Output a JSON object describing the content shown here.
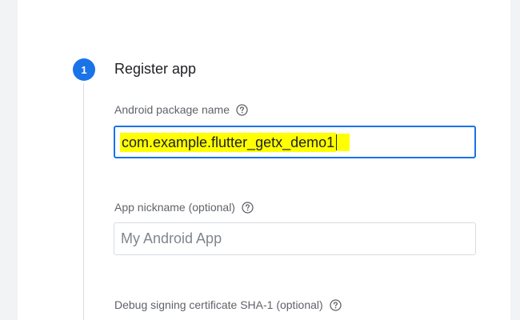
{
  "step": {
    "number": "1",
    "title": "Register app"
  },
  "fields": {
    "package_name": {
      "label": "Android package name",
      "value": "com.example.flutter_getx_demo1"
    },
    "nickname": {
      "label": "App nickname (optional)",
      "placeholder": "My Android App"
    },
    "sha1": {
      "label": "Debug signing certificate SHA-1 (optional)"
    }
  },
  "colors": {
    "accent": "#1a73e8",
    "highlight": "#ffff00"
  },
  "icons": {
    "help": "help-circle-icon"
  }
}
